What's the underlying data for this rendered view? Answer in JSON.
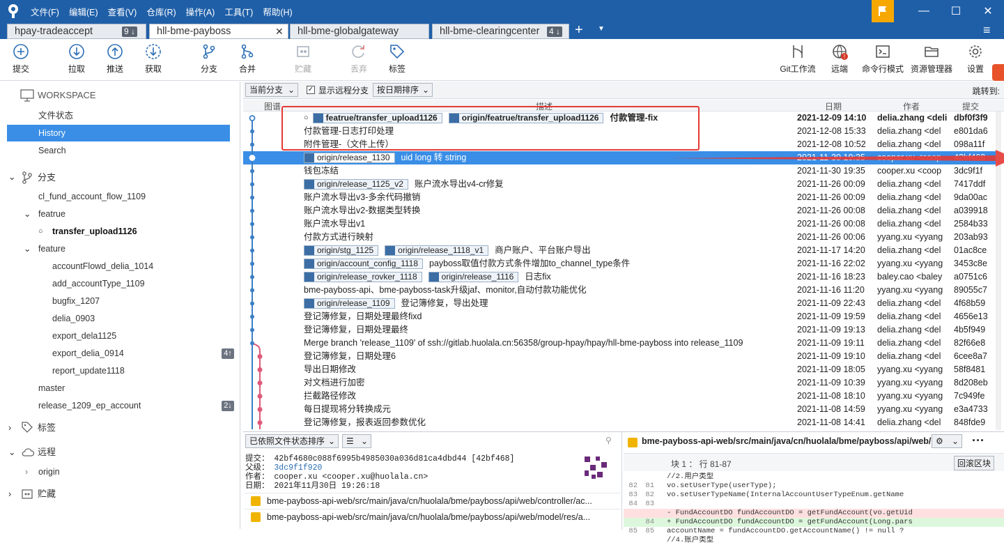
{
  "app": {
    "menus": [
      "文件(F)",
      "编辑(E)",
      "查看(V)",
      "仓库(R)",
      "操作(A)",
      "工具(T)",
      "帮助(H)"
    ]
  },
  "tabs": [
    {
      "label": "hpay-tradeaccept",
      "badge": "9 ↓"
    },
    {
      "label": "hll-bme-payboss",
      "badge": ""
    },
    {
      "label": "hll-bme-globalgateway",
      "badge": ""
    },
    {
      "label": "hll-bme-clearingcenter",
      "badge": "4 ↓"
    }
  ],
  "toolbar": {
    "commit": "提交",
    "pull": "拉取",
    "push": "推送",
    "fetch": "获取",
    "branch": "分支",
    "merge": "合并",
    "stash": "贮藏",
    "discard": "丢弃",
    "tag": "标签",
    "gitflow": "Git工作流",
    "remote": "远端",
    "terminal": "命令行模式",
    "explorer": "资源管理器",
    "settings": "设置"
  },
  "sidebar": {
    "workspace": "WORKSPACE",
    "file_status": "文件状态",
    "history": "History",
    "search": "Search",
    "branches": "分支",
    "b1": "cl_fund_account_flow_1109",
    "featrue": "featrue",
    "transfer": "transfer_upload1126",
    "feature": "feature",
    "f1": "accountFlowd_delia_1014",
    "f2": "add_accountType_1109",
    "f3": "bugfix_1207",
    "f4": "delia_0903",
    "f5": "export_dela1125",
    "f6": "export_delia_0914",
    "f6_badge": "4↑",
    "f7": "report_update1118",
    "master": "master",
    "release": "release_1209_ep_account",
    "release_badge": "2↓",
    "tags": "标签",
    "remotes": "远程",
    "origin": "origin",
    "stashes": "贮藏"
  },
  "filters": {
    "branch_sel": "当前分支",
    "show_remote": "显示远程分支",
    "sort": "按日期排序",
    "jump": "跳转到:"
  },
  "columns": {
    "graph": "图谱",
    "desc": "描述",
    "date": "日期",
    "author": "作者",
    "commit": "提交"
  },
  "commits": [
    {
      "refs": [
        "featrue/transfer_upload1126",
        "origin/featrue/transfer_upload1126"
      ],
      "msg": "付款管理-fix",
      "date": "2021-12-09 14:10",
      "author": "delia.zhang <delia",
      "hash": "dbf0f3f9"
    },
    {
      "refs": [],
      "msg": "付款管理-日志打印处理",
      "date": "2021-12-08 15:33",
      "author": "delia.zhang <del",
      "hash": "e801da6"
    },
    {
      "refs": [],
      "msg": "附件管理-（文件上传）",
      "date": "2021-12-08 10:52",
      "author": "delia.zhang <del",
      "hash": "098a11f"
    },
    {
      "refs": [
        "origin/release_1130"
      ],
      "msg": "uid long 转 string",
      "date": "2021-11-30 19:35",
      "author": "cooper.xu <coop",
      "hash": "42bf468"
    },
    {
      "refs": [],
      "msg": "钱包冻结",
      "date": "2021-11-30 19:35",
      "author": "cooper.xu <coop",
      "hash": "3dc9f1f"
    },
    {
      "refs": [
        "origin/release_1125_v2"
      ],
      "msg": "账户流水导出v4-cr修复",
      "date": "2021-11-26 00:09",
      "author": "delia.zhang <del",
      "hash": "7417ddf"
    },
    {
      "refs": [],
      "msg": "账户流水导出v3-多余代码撤销",
      "date": "2021-11-26 00:09",
      "author": "delia.zhang <del",
      "hash": "9da00ac"
    },
    {
      "refs": [],
      "msg": "账户流水导出v2-数据类型转换",
      "date": "2021-11-26 00:08",
      "author": "delia.zhang <del",
      "hash": "a039918"
    },
    {
      "refs": [],
      "msg": "账户流水导出v1",
      "date": "2021-11-26 00:08",
      "author": "delia.zhang <del",
      "hash": "2584b33"
    },
    {
      "refs": [],
      "msg": "付款方式进行映射",
      "date": "2021-11-26 00:06",
      "author": "yyang.xu <yyang",
      "hash": "203ab93"
    },
    {
      "refs": [
        "origin/stg_1125",
        "origin/release_1118_v1"
      ],
      "msg": "商户账户、平台账户导出",
      "date": "2021-11-17 14:20",
      "author": "delia.zhang <del",
      "hash": "01ac8ce"
    },
    {
      "refs": [
        "origin/account_config_1118"
      ],
      "msg": "payboss取值付款方式条件增加to_channel_type条件",
      "date": "2021-11-16 22:02",
      "author": "yyang.xu <yyang",
      "hash": "3453c8e"
    },
    {
      "refs": [
        "origin/release_rovker_1118",
        "origin/release_1116"
      ],
      "msg": "日志fix",
      "date": "2021-11-16 18:23",
      "author": "baley.cao <baley",
      "hash": "a0751c6"
    },
    {
      "refs": [],
      "msg": "bme-payboss-api、bme-payboss-task升级jaf、monitor,自动付款功能优化",
      "date": "2021-11-16 11:20",
      "author": "yyang.xu <yyang",
      "hash": "89055c7"
    },
    {
      "refs": [
        "origin/release_1109"
      ],
      "msg": "登记簿修复，导出处理",
      "date": "2021-11-09 22:43",
      "author": "delia.zhang <del",
      "hash": "4f68b59"
    },
    {
      "refs": [],
      "msg": "登记簿修复，日期处理最终fixd",
      "date": "2021-11-09 19:59",
      "author": "delia.zhang <del",
      "hash": "4656e13"
    },
    {
      "refs": [],
      "msg": "登记簿修复，日期处理最终",
      "date": "2021-11-09 19:13",
      "author": "delia.zhang <del",
      "hash": "4b5f949"
    },
    {
      "refs": [],
      "msg": "Merge branch 'release_1109' of ssh://gitlab.huolala.cn:56358/group-hpay/hpay/hll-bme-payboss into release_1109",
      "date": "2021-11-09 19:11",
      "author": "delia.zhang <del",
      "hash": "82f66e8"
    },
    {
      "refs": [],
      "msg": "登记簿修复，日期处理6",
      "date": "2021-11-09 19:10",
      "author": "delia.zhang <del",
      "hash": "6cee8a7"
    },
    {
      "refs": [],
      "msg": "导出日期修改",
      "date": "2021-11-09 18:05",
      "author": "yyang.xu <yyang",
      "hash": "58f8481"
    },
    {
      "refs": [],
      "msg": "对文档进行加密",
      "date": "2021-11-09 10:39",
      "author": "yyang.xu <yyang",
      "hash": "8d208eb"
    },
    {
      "refs": [],
      "msg": "拦截路径修改",
      "date": "2021-11-08 18:10",
      "author": "yyang.xu <yyang",
      "hash": "7c949fe"
    },
    {
      "refs": [],
      "msg": "每日提现将分转换成元",
      "date": "2021-11-08 14:59",
      "author": "yyang.xu <yyang",
      "hash": "e3a4733"
    },
    {
      "refs": [],
      "msg": "登记簿修复，报表返回参数优化",
      "date": "2021-11-08 14:41",
      "author": "delia.zhang <del",
      "hash": "848fde9"
    }
  ],
  "bottom": {
    "sort": "已依照文件状态排序",
    "commit_label": "提交：",
    "commit_val": "42bf4680c088f6995b4985030a036d81ca4dbd44 [42bf468]",
    "parent_label": "父级：",
    "parent_val": "3dc9f1f920",
    "author_label": "作者：",
    "author_val": "cooper.xu <cooper.xu@huolala.cn>",
    "date_label": "日期：",
    "date_val": "2021年11月30日 19:26:18",
    "file1": "bme-payboss-api-web/src/main/java/cn/huolala/bme/payboss/api/web/controller/ac...",
    "file2": "bme-payboss-api-web/src/main/java/cn/huolala/bme/payboss/api/web/model/res/a...",
    "diff_path": "bme-payboss-api-web/src/main/java/cn/huolala/bme/payboss/api/web/c...",
    "hunk": "块 1 ： 行 81-87",
    "revert": "回滚区块"
  },
  "diff": [
    {
      "a": "",
      "b": "",
      "kind": "ctx",
      "text": "                          //2.用户类型"
    },
    {
      "a": "82",
      "b": "81",
      "kind": "ctx",
      "text": "                          vo.setUserType(userType);"
    },
    {
      "a": "83",
      "b": "82",
      "kind": "ctx",
      "text": "                          vo.setUserTypeName(InternalAccountUserTypeEnum.getName"
    },
    {
      "a": "84",
      "b": "83",
      "kind": "ctx",
      "text": ""
    },
    {
      "a": "",
      "b": "",
      "kind": "rem",
      "text": "-                         FundAccountDO fundAccountDO = getFundAccount(vo.getUid"
    },
    {
      "a": "",
      "b": "84",
      "kind": "add",
      "text": "+                         FundAccountDO fundAccountDO = getFundAccount(Long.pars"
    },
    {
      "a": "85",
      "b": "85",
      "kind": "ctx",
      "text": "                          accountName = fundAccountDO.getAccountName() != null ?"
    },
    {
      "a": "",
      "b": "",
      "kind": "ctx",
      "text": "                          //4.账户类型"
    }
  ],
  "colors": {
    "brand": "#1f5fa8",
    "selection": "#3a8ee6",
    "highlight": "#e53935",
    "graph": "#3b7fc4",
    "graph2": "#e05a7a"
  }
}
